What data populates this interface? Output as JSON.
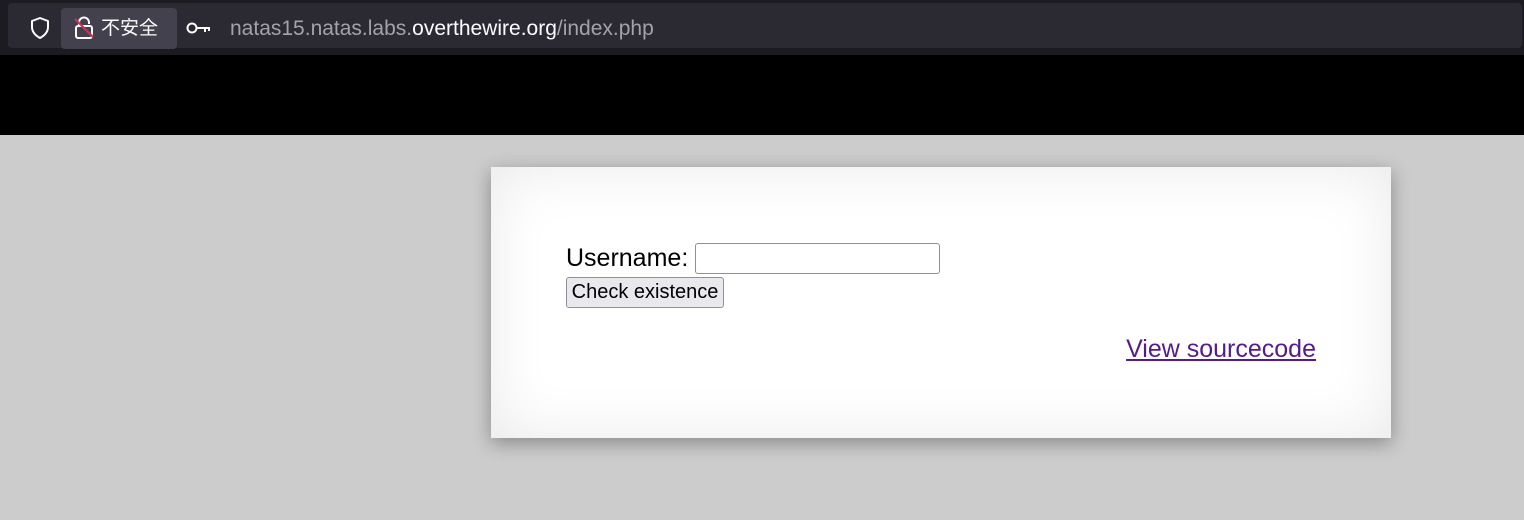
{
  "browser": {
    "security_label": "不安全",
    "url_prefix": "natas15.natas.labs.",
    "url_host": "overthewire.org",
    "url_path": "/index.php",
    "icons": {
      "shield": "shield-icon",
      "lock": "insecure-lock-icon",
      "key": "key-icon"
    },
    "colors": {
      "toolbar_bg": "#1c1b22",
      "urlbar_bg": "#2b2a33",
      "security_pill_bg": "#42414d",
      "insecure_strike": "#e22850"
    }
  },
  "page": {
    "header_color": "#000000",
    "background_color": "#cccccc",
    "form": {
      "username_label": "Username:",
      "username_value": "",
      "submit_label": "Check existence"
    },
    "source_link": "View sourcecode",
    "link_color": "#551a8b"
  }
}
